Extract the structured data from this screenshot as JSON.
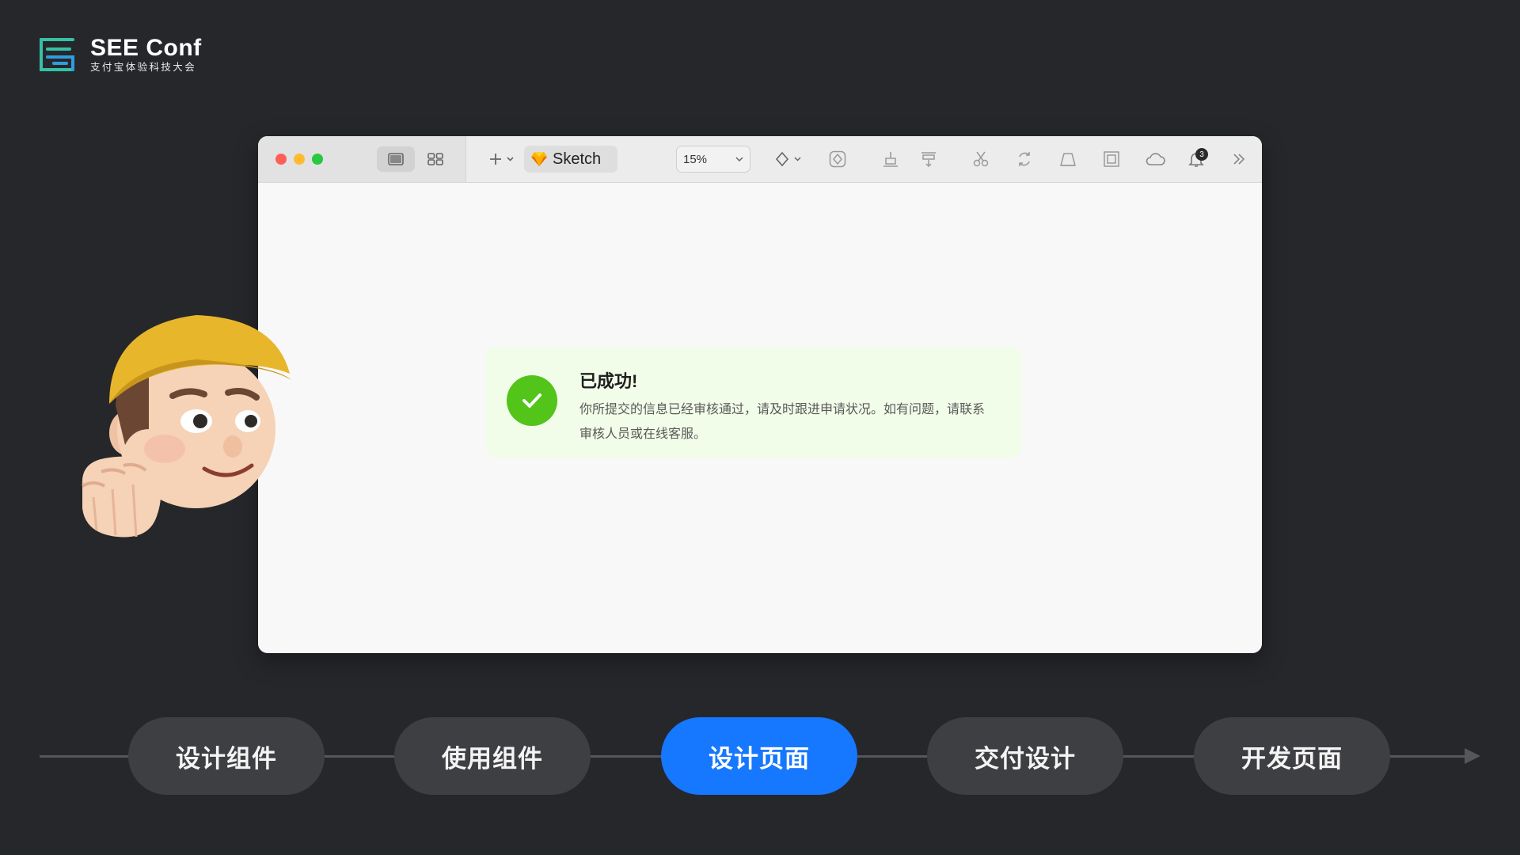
{
  "logo": {
    "title": "SEE Conf",
    "subtitle": "支付宝体验科技大会"
  },
  "window": {
    "toolbar": {
      "document_name": "Sketch",
      "zoom": "15%",
      "notification_count": "3"
    },
    "alert": {
      "title": "已成功!",
      "description": "你所提交的信息已经审核通过，请及时跟进申请状况。如有问题，请联系审核人员或在线客服。",
      "status_color": "#52c41a",
      "background_color": "#f1fde8"
    }
  },
  "timeline": {
    "steps": [
      {
        "label": "设计组件"
      },
      {
        "label": "使用组件"
      },
      {
        "label": "设计页面",
        "active": true
      },
      {
        "label": "交付设计"
      },
      {
        "label": "开发页面"
      }
    ],
    "active_color": "#1677ff"
  }
}
